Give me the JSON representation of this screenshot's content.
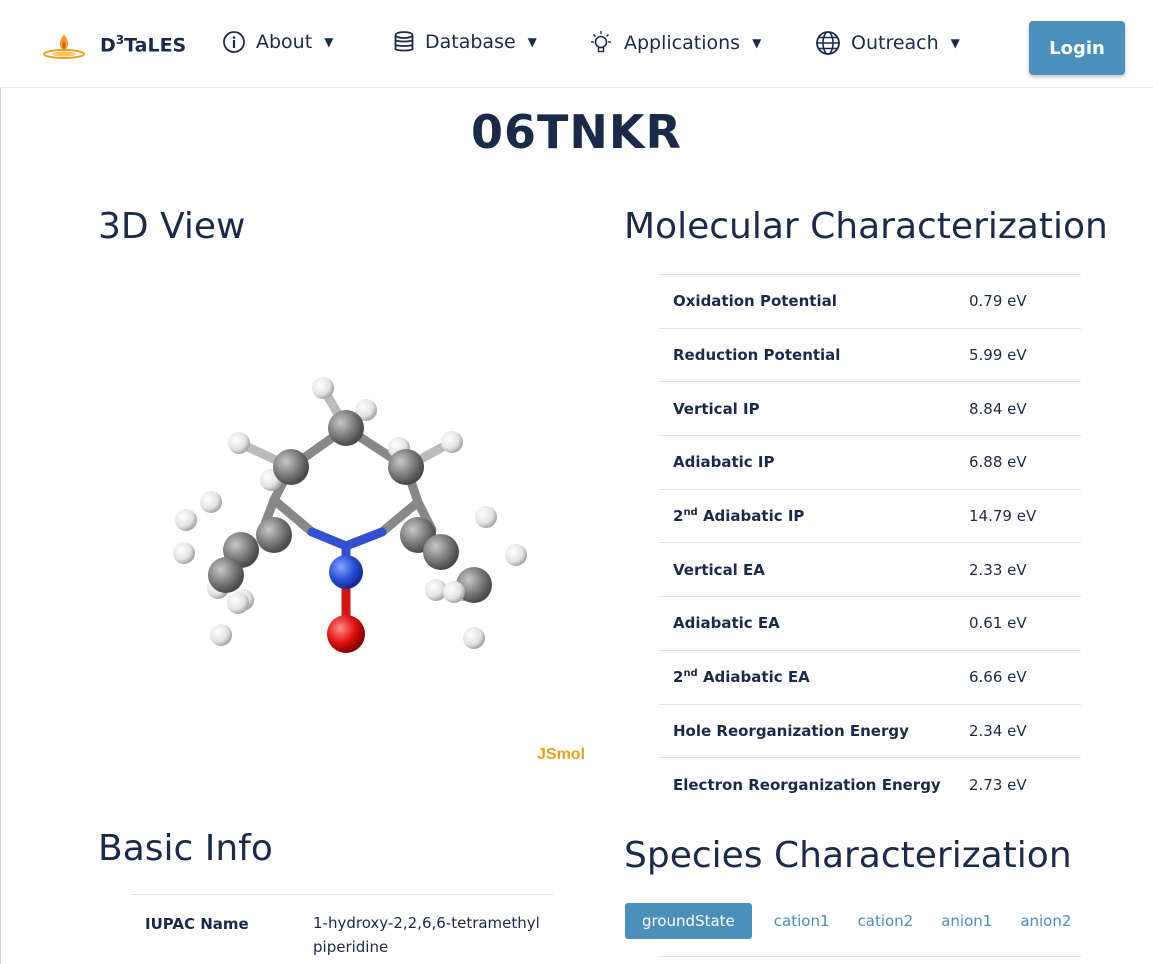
{
  "nav": {
    "brand": "D",
    "brand_sup": "3",
    "brand_rest": "TaLES",
    "items": [
      {
        "label": "About",
        "icon": "info-icon"
      },
      {
        "label": "Database",
        "icon": "database-icon"
      },
      {
        "label": "Applications",
        "icon": "lightbulb-icon"
      },
      {
        "label": "Outreach",
        "icon": "globe-icon"
      }
    ],
    "login": "Login"
  },
  "title": "06TNKR",
  "view": {
    "heading": "3D View",
    "viewer_label": "JSmol"
  },
  "molecular": {
    "heading": "Molecular Characterization",
    "rows": [
      {
        "pre": "",
        "sup": "",
        "label": "Oxidation Potential",
        "value": "0.79 eV"
      },
      {
        "pre": "",
        "sup": "",
        "label": "Reduction Potential",
        "value": "5.99 eV"
      },
      {
        "pre": "",
        "sup": "",
        "label": "Vertical IP",
        "value": "8.84 eV"
      },
      {
        "pre": "",
        "sup": "",
        "label": "Adiabatic IP",
        "value": "6.88 eV"
      },
      {
        "pre": "2",
        "sup": "nd",
        "label": " Adiabatic IP",
        "value": "14.79 eV"
      },
      {
        "pre": "",
        "sup": "",
        "label": "Vertical EA",
        "value": "2.33 eV"
      },
      {
        "pre": "",
        "sup": "",
        "label": "Adiabatic EA",
        "value": "0.61 eV"
      },
      {
        "pre": "2",
        "sup": "nd",
        "label": " Adiabatic EA",
        "value": "6.66 eV"
      },
      {
        "pre": "",
        "sup": "",
        "label": "Hole Reorganization Energy",
        "value": "2.34 eV"
      },
      {
        "pre": "",
        "sup": "",
        "label": "Electron Reorganization Energy",
        "value": "2.73 eV"
      }
    ]
  },
  "basic": {
    "heading": "Basic Info",
    "rows": [
      {
        "label": "IUPAC Name",
        "value": "1-hydroxy-2,2,6,6-tetramethylpiperidine"
      }
    ]
  },
  "species": {
    "heading": "Species Characterization",
    "tabs": [
      "groundState",
      "cation1",
      "cation2",
      "anion1",
      "anion2"
    ],
    "active": "groundState"
  },
  "colors": {
    "navy": "#1c2a4a",
    "accent": "#4b8fbd",
    "jsmol": "#f0a020",
    "carbon": "#7a7a7a",
    "hydrogen": "#eeeeee",
    "nitrogen": "#2b4fd8",
    "oxygen": "#e01010"
  }
}
